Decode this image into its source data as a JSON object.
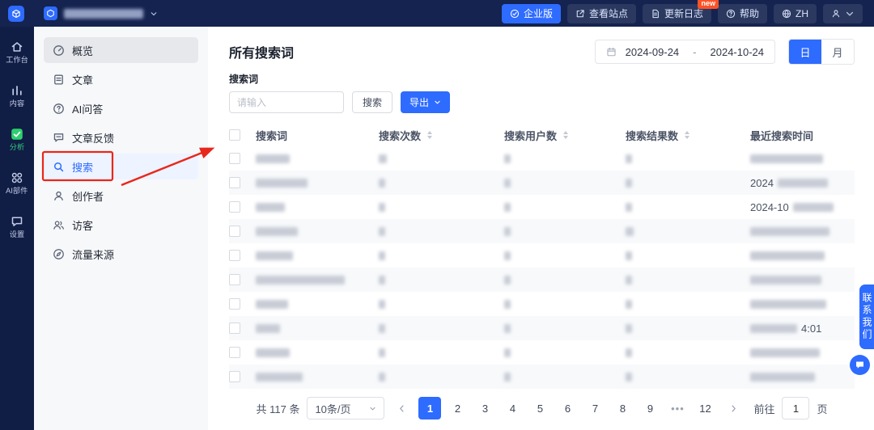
{
  "colors": {
    "accent_blue": "#2e6bff",
    "topbar_bg": "#14234f",
    "rail_bg": "#101d45",
    "active_green": "#2ecf6e",
    "annotation_red": "#e8271c",
    "badge_red": "#ff5126"
  },
  "topbar": {
    "enterprise": "企业版",
    "view_site": "查看站点",
    "changelog": "更新日志",
    "changelog_badge": "new",
    "help": "帮助",
    "language": "ZH"
  },
  "rail": {
    "items": [
      {
        "id": "workbench",
        "label": "工作台",
        "icon": "home-icon",
        "active": false
      },
      {
        "id": "content",
        "label": "内容",
        "icon": "content-icon",
        "active": false
      },
      {
        "id": "analysis",
        "label": "分析",
        "icon": "analysis-check-icon",
        "active": true
      },
      {
        "id": "ai-widgets",
        "label": "AI部件",
        "icon": "ai-widget-icon",
        "active": false
      },
      {
        "id": "settings",
        "label": "设置",
        "icon": "settings-bubble-icon",
        "active": false
      }
    ]
  },
  "sidebar": {
    "items": [
      {
        "id": "overview",
        "label": "概览",
        "icon": "overview-icon",
        "selected": true,
        "highlighted": false
      },
      {
        "id": "articles",
        "label": "文章",
        "icon": "article-icon",
        "selected": false,
        "highlighted": false
      },
      {
        "id": "ai-qa",
        "label": "AI问答",
        "icon": "ai-qa-icon",
        "selected": false,
        "highlighted": false
      },
      {
        "id": "article-feedback",
        "label": "文章反馈",
        "icon": "feedback-icon",
        "selected": false,
        "highlighted": false
      },
      {
        "id": "search",
        "label": "搜索",
        "icon": "search-icon",
        "selected": false,
        "highlighted": true
      },
      {
        "id": "creators",
        "label": "创作者",
        "icon": "creator-icon",
        "selected": false,
        "highlighted": false
      },
      {
        "id": "visitors",
        "label": "访客",
        "icon": "visitor-icon",
        "selected": false,
        "highlighted": false
      },
      {
        "id": "traffic-sources",
        "label": "流量来源",
        "icon": "traffic-icon",
        "selected": false,
        "highlighted": false
      }
    ]
  },
  "main": {
    "title": "所有搜索词",
    "date_start": "2024-09-24",
    "date_separator": "-",
    "date_end": "2024-10-24",
    "day_label": "日",
    "month_label": "月",
    "filter_label": "搜索词",
    "input_placeholder": "请输入",
    "search_button": "搜索",
    "export_button": "导出",
    "table": {
      "columns": [
        {
          "label": "搜索词",
          "sortable": false
        },
        {
          "label": "搜索次数",
          "sortable": true
        },
        {
          "label": "搜索用户数",
          "sortable": true
        },
        {
          "label": "搜索结果数",
          "sortable": true
        },
        {
          "label": "最近搜索时间",
          "sortable": false
        }
      ],
      "rows": [
        {
          "term_w": 42,
          "count_w": 10,
          "users_w": 8,
          "results_w": 8,
          "time_pre": "",
          "time_blur_w": 90,
          "time_post": ""
        },
        {
          "term_w": 64,
          "count_w": 8,
          "users_w": 8,
          "results_w": 8,
          "time_pre": "2024",
          "time_blur_w": 62,
          "time_post": ""
        },
        {
          "term_w": 36,
          "count_w": 8,
          "users_w": 8,
          "results_w": 8,
          "time_pre": "2024-10",
          "time_blur_w": 50,
          "time_post": ""
        },
        {
          "term_w": 52,
          "count_w": 8,
          "users_w": 8,
          "results_w": 10,
          "time_pre": "",
          "time_blur_w": 98,
          "time_post": ""
        },
        {
          "term_w": 46,
          "count_w": 8,
          "users_w": 8,
          "results_w": 8,
          "time_pre": "",
          "time_blur_w": 92,
          "time_post": ""
        },
        {
          "term_w": 110,
          "count_w": 8,
          "users_w": 8,
          "results_w": 8,
          "time_pre": "",
          "time_blur_w": 88,
          "time_post": ""
        },
        {
          "term_w": 40,
          "count_w": 8,
          "users_w": 8,
          "results_w": 8,
          "time_pre": "",
          "time_blur_w": 94,
          "time_post": ""
        },
        {
          "term_w": 30,
          "count_w": 8,
          "users_w": 8,
          "results_w": 8,
          "time_pre": "",
          "time_blur_w": 58,
          "time_post": "4:01"
        },
        {
          "term_w": 42,
          "count_w": 8,
          "users_w": 8,
          "results_w": 8,
          "time_pre": "",
          "time_blur_w": 86,
          "time_post": ""
        },
        {
          "term_w": 58,
          "count_w": 8,
          "users_w": 8,
          "results_w": 8,
          "time_pre": "",
          "time_blur_w": 80,
          "time_post": ""
        }
      ]
    },
    "pagination": {
      "total": "共 117 条",
      "page_size": "10条/页",
      "pages": [
        "1",
        "2",
        "3",
        "4",
        "5",
        "6",
        "7",
        "8",
        "9",
        "•••",
        "12"
      ],
      "current": "1",
      "ellipsis": "•••",
      "goto_label": "前往",
      "goto_value": "1",
      "unit": "页"
    }
  },
  "contact": {
    "label": "联系我们"
  }
}
